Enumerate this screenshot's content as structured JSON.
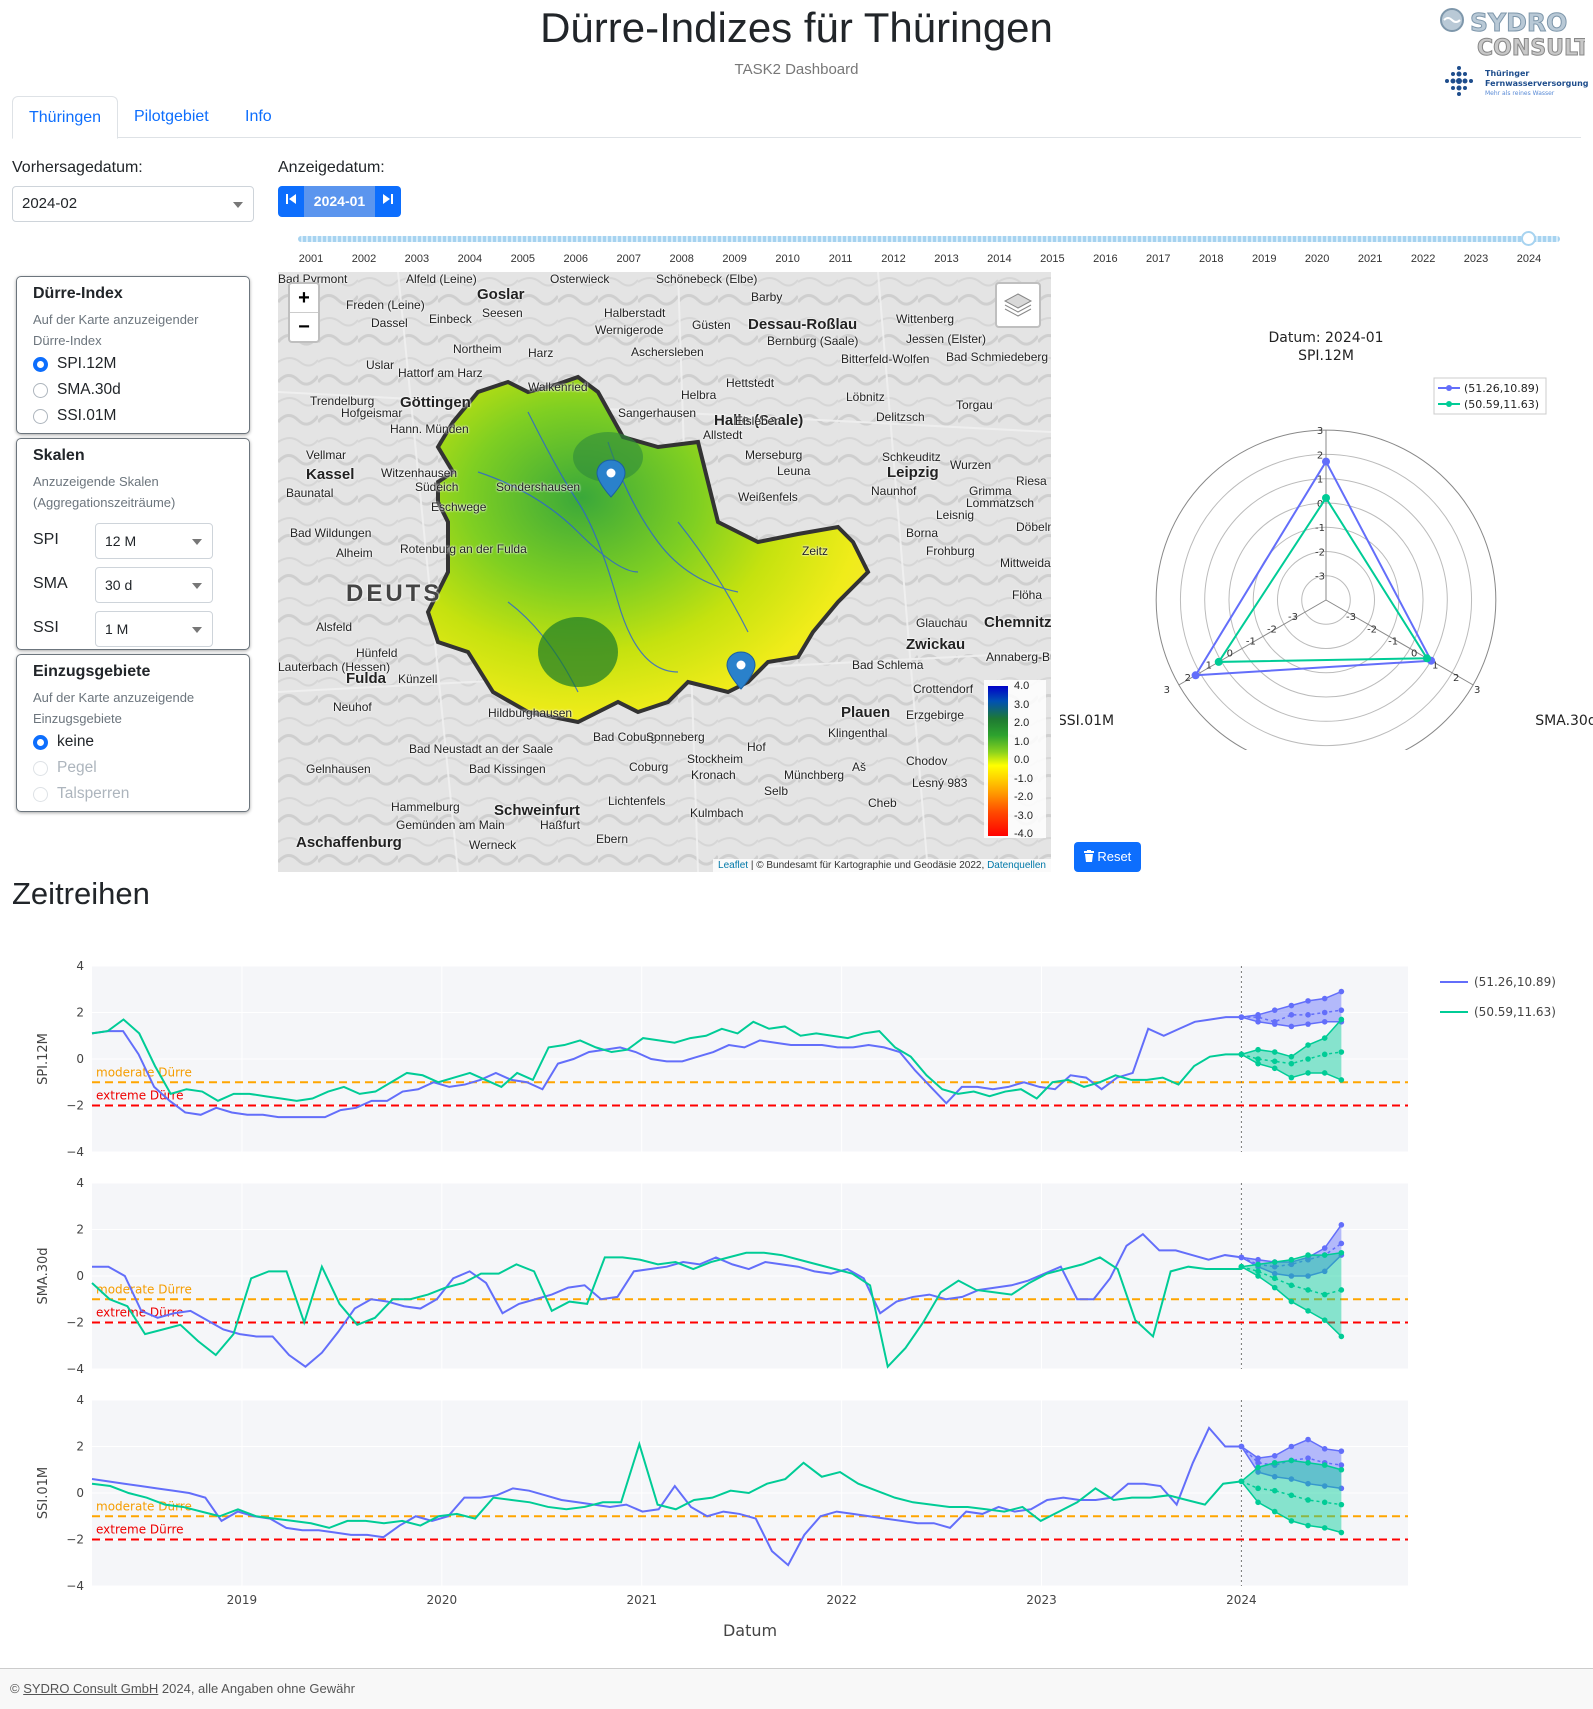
{
  "header": {
    "title": "Dürre-Indizes für Thüringen",
    "subtitle": "TASK2 Dashboard",
    "logo1": "SYDRO CONSULT",
    "logo2_line1": "Thüringer",
    "logo2_line2": "Fernwasserversorgung",
    "logo2_line3": "Mehr als reines Wasser"
  },
  "tabs": [
    {
      "label": "Thüringen",
      "active": true
    },
    {
      "label": "Pilotgebiet",
      "active": false
    },
    {
      "label": "Info",
      "active": false
    }
  ],
  "controls": {
    "vorhersage_label": "Vorhersagedatum:",
    "vorhersage_value": "2024-02",
    "anzeige_label": "Anzeigedatum:",
    "anzeige_value": "2024-01",
    "slider_years": [
      "2001",
      "2002",
      "2003",
      "2004",
      "2005",
      "2006",
      "2007",
      "2008",
      "2009",
      "2010",
      "2011",
      "2012",
      "2013",
      "2014",
      "2015",
      "2016",
      "2017",
      "2018",
      "2019",
      "2020",
      "2021",
      "2022",
      "2023",
      "2024"
    ],
    "slider_position": 1.0
  },
  "panels": {
    "index": {
      "title": "Dürre-Index",
      "desc": "Auf der Karte anzuzeigender Dürre-Index",
      "options": [
        {
          "label": "SPI.12M",
          "checked": true
        },
        {
          "label": "SMA.30d",
          "checked": false
        },
        {
          "label": "SSI.01M",
          "checked": false
        }
      ]
    },
    "scales": {
      "title": "Skalen",
      "desc": "Anzuzeigende Skalen (Aggregationszeiträume)",
      "rows": [
        {
          "label": "SPI",
          "value": "12 M"
        },
        {
          "label": "SMA",
          "value": "30 d"
        },
        {
          "label": "SSI",
          "value": "1 M"
        }
      ]
    },
    "catchments": {
      "title": "Einzugsgebiete",
      "desc": "Auf der Karte anzuzeigende Einzugsgebiete",
      "options": [
        {
          "label": "keine",
          "checked": true,
          "disabled": false
        },
        {
          "label": "Pegel",
          "checked": false,
          "disabled": true
        },
        {
          "label": "Talsperren",
          "checked": false,
          "disabled": true
        }
      ]
    }
  },
  "map": {
    "zoom_in": "+",
    "zoom_out": "−",
    "attribution_leaflet": "Leaflet",
    "attribution_text": " | © Bundesamt für Kartographie und Geodäsie 2022, ",
    "attribution_link": "Datenquellen",
    "legend_ticks": [
      "4.0",
      "3.0",
      "2.0",
      "1.0",
      "0.0",
      "-1.0",
      "-2.0",
      "-3.0",
      "-4.0"
    ],
    "towns": [
      {
        "name": "Bad Pyrmont"
      },
      {
        "name": "Alfeld (Leine)"
      },
      {
        "name": "Goslar"
      },
      {
        "name": "Osterwieck"
      },
      {
        "name": "Schönebeck (Elbe)"
      },
      {
        "name": "Barby"
      },
      {
        "name": "Freden (Leine)"
      },
      {
        "name": "Halberstadt"
      },
      {
        "name": "Dessau-Roßlau"
      },
      {
        "name": "Wittenberg"
      },
      {
        "name": "Dassel"
      },
      {
        "name": "Einbeck"
      },
      {
        "name": "Seesen"
      },
      {
        "name": "Wernigerode"
      },
      {
        "name": "Güsten"
      },
      {
        "name": "Bernburg (Saale)"
      },
      {
        "name": "Jessen (Elster)"
      },
      {
        "name": "Northeim"
      },
      {
        "name": "Harz"
      },
      {
        "name": "Aschersleben"
      },
      {
        "name": "Bitterfeld-Wolfen"
      },
      {
        "name": "Bad Schmiedeberg"
      },
      {
        "name": "Uslar"
      },
      {
        "name": "Hattorf am Harz"
      },
      {
        "name": "Hettstedt"
      },
      {
        "name": "Walkenried"
      },
      {
        "name": "Löbnitz"
      },
      {
        "name": "Trendelburg"
      },
      {
        "name": "Göttingen"
      },
      {
        "name": "Helbra"
      },
      {
        "name": "Torgau"
      },
      {
        "name": "Hofgeismar"
      },
      {
        "name": "Sangerhausen"
      },
      {
        "name": "Halle (Saale)"
      },
      {
        "name": "Delitzsch"
      },
      {
        "name": "Hann. Münden"
      },
      {
        "name": "Eisleben"
      },
      {
        "name": "Allstedt"
      },
      {
        "name": "Vellmar"
      },
      {
        "name": "Merseburg"
      },
      {
        "name": "Schkeuditz"
      },
      {
        "name": "Wurzen"
      },
      {
        "name": "Kassel"
      },
      {
        "name": "Witzenhausen"
      },
      {
        "name": "Leuna"
      },
      {
        "name": "Leipzig"
      },
      {
        "name": "Baunatal"
      },
      {
        "name": "Sondershausen"
      },
      {
        "name": "Naunhof"
      },
      {
        "name": "Riesa"
      },
      {
        "name": "Südeich"
      },
      {
        "name": "Weißenfels"
      },
      {
        "name": "Grimma"
      },
      {
        "name": "Lommatzsch"
      },
      {
        "name": "Eschwege"
      },
      {
        "name": "Leisnig"
      },
      {
        "name": "Bad Wildungen"
      },
      {
        "name": "Borna"
      },
      {
        "name": "Döbeln"
      },
      {
        "name": "Rotenburg an der Fulda"
      },
      {
        "name": "Alheim"
      },
      {
        "name": "Zeitz"
      },
      {
        "name": "Frohburg"
      },
      {
        "name": "Mittweida"
      },
      {
        "name": "DEUTS"
      },
      {
        "name": "Flöha"
      },
      {
        "name": "Alsfeld"
      },
      {
        "name": "Glauchau"
      },
      {
        "name": "Chemnitz"
      },
      {
        "name": "Zwickau"
      },
      {
        "name": "Hünfeld"
      },
      {
        "name": "Lauterbach (Hessen)"
      },
      {
        "name": "Fulda"
      },
      {
        "name": "Künzell"
      },
      {
        "name": "Bad Schlema"
      },
      {
        "name": "Annaberg-Buchholz"
      },
      {
        "name": "Crottendorf"
      },
      {
        "name": "Neuhof"
      },
      {
        "name": "Plauen"
      },
      {
        "name": "Hildburghausen"
      },
      {
        "name": "Erzgebirge"
      },
      {
        "name": "Klingenthal"
      },
      {
        "name": "Bad Coburg"
      },
      {
        "name": "Sonneberg"
      },
      {
        "name": "Gelnhausen"
      },
      {
        "name": "Bad Neustadt an der Saale"
      },
      {
        "name": "Hof"
      },
      {
        "name": "Bad Kissingen"
      },
      {
        "name": "Coburg"
      },
      {
        "name": "Stockheim"
      },
      {
        "name": "Chodov"
      },
      {
        "name": "Kronach"
      },
      {
        "name": "Münchberg"
      },
      {
        "name": "Aš"
      },
      {
        "name": "Selb"
      },
      {
        "name": "Cheb"
      },
      {
        "name": "Hammelburg"
      },
      {
        "name": "Schweinfurt"
      },
      {
        "name": "Lichtenfels"
      },
      {
        "name": "Gemünden am Main"
      },
      {
        "name": "Haßfurt"
      },
      {
        "name": "Ebern"
      },
      {
        "name": "Kulmbach"
      },
      {
        "name": "Aschaffenburg"
      },
      {
        "name": "Werneck"
      },
      {
        "name": "Lesný 983"
      }
    ],
    "markers": [
      {
        "lat": 51.26,
        "lon": 10.89
      },
      {
        "lat": 50.59,
        "lon": 11.63
      }
    ]
  },
  "radar": {
    "title_line1": "Datum: 2024-01",
    "axes": [
      "SPI.12M",
      "SMA.30d",
      "SSI.01M"
    ],
    "radial_ticks": [
      "-3",
      "-2",
      "-1",
      "0",
      "1",
      "2",
      "3"
    ],
    "range": [
      -4,
      3
    ],
    "series": [
      {
        "name": "(51.26,10.89)",
        "color": "#636efa",
        "values": [
          1.7,
          1.0,
          2.2
        ]
      },
      {
        "name": "(50.59,11.63)",
        "color": "#00cc96",
        "values": [
          0.2,
          0.8,
          1.1
        ]
      }
    ]
  },
  "reset_label": "Reset",
  "section_title": "Zeitreihen",
  "chart_data": {
    "type": "line",
    "x_start": "2018-04",
    "x_ticks": [
      "2019",
      "2020",
      "2021",
      "2022",
      "2023",
      "2024"
    ],
    "xlabel": "Datum",
    "ylim": [
      -4,
      4
    ],
    "y_ticks": [
      "4",
      "2",
      "0",
      "−2",
      "−4"
    ],
    "forecast_start": "2024-01",
    "thresholds": [
      {
        "label": "moderate Dürre",
        "value": -1,
        "color": "#ffa500"
      },
      {
        "label": "extreme Dürre",
        "value": -2,
        "color": "#ff0000"
      }
    ],
    "series_names": [
      "(51.26,10.89)",
      "(50.59,11.63)"
    ],
    "series_colors": [
      "#636efa",
      "#00cc96"
    ],
    "panels": [
      {
        "ylabel": "SPI.12M",
        "blue": [
          1.1,
          1.2,
          1.2,
          0.2,
          -1.2,
          -1.8,
          -2.3,
          -2.4,
          -2.1,
          -2.3,
          -2.4,
          -2.4,
          -2.5,
          -2.5,
          -2.5,
          -2.5,
          -2.2,
          -2.1,
          -1.8,
          -1.8,
          -1.4,
          -1.3,
          -1.0,
          -1.2,
          -1.1,
          -0.9,
          -0.6,
          -0.9,
          -1.0,
          -1.3,
          -0.2,
          0.0,
          0.3,
          0.4,
          0.5,
          0.3,
          0.0,
          -0.1,
          -0.1,
          0.1,
          0.3,
          0.6,
          0.5,
          0.8,
          0.7,
          0.6,
          0.6,
          0.6,
          0.5,
          0.5,
          0.6,
          0.5,
          0.3,
          -0.5,
          -1.2,
          -1.9,
          -1.2,
          -1.2,
          -1.3,
          -1.2,
          -1.0,
          -1.2,
          -1.3,
          -0.7,
          -0.8,
          -1.3,
          -0.8,
          -0.6,
          1.3,
          1.0,
          1.3,
          1.6,
          1.7,
          1.8,
          1.8
        ],
        "green": [
          1.1,
          1.2,
          1.7,
          1.1,
          -0.3,
          -1.5,
          -1.3,
          -1.4,
          -1.8,
          -1.5,
          -1.5,
          -1.6,
          -1.7,
          -1.8,
          -1.7,
          -1.4,
          -1.2,
          -1.5,
          -1.4,
          -1.0,
          -0.6,
          -0.7,
          -1.0,
          -0.8,
          -0.6,
          -0.9,
          -1.2,
          -0.6,
          -0.9,
          0.5,
          0.6,
          0.8,
          0.5,
          0.3,
          0.4,
          0.9,
          0.8,
          0.7,
          0.9,
          1.0,
          1.3,
          1.1,
          1.6,
          1.3,
          1.4,
          1.0,
          1.1,
          1.0,
          0.9,
          1.1,
          1.2,
          0.5,
          0.1,
          -0.7,
          -1.3,
          -1.5,
          -1.4,
          -1.6,
          -1.4,
          -1.3,
          -1.7,
          -1.0,
          -0.9,
          -1.2,
          -1.0,
          -0.7,
          -0.9,
          -0.9,
          -0.8,
          -1.1,
          -0.3,
          0.1,
          0.2,
          0.2
        ],
        "fc_blue": {
          "upper": [
            1.8,
            1.9,
            2.1,
            2.3,
            2.5,
            2.6,
            2.9
          ],
          "mid": [
            1.8,
            1.8,
            1.6,
            1.9,
            1.9,
            2.0,
            2.1
          ],
          "lower": [
            1.8,
            1.6,
            1.5,
            1.4,
            1.5,
            1.6,
            1.6
          ]
        },
        "fc_green": {
          "upper": [
            0.2,
            0.4,
            0.3,
            0.1,
            0.6,
            0.9,
            1.7
          ],
          "mid": [
            0.2,
            0.0,
            -0.1,
            -0.2,
            0.0,
            0.2,
            0.3
          ],
          "lower": [
            0.2,
            -0.2,
            -0.4,
            -0.8,
            -0.6,
            -0.6,
            -0.9
          ]
        }
      },
      {
        "ylabel": "SMA.30d",
        "blue": [
          0.4,
          0.4,
          0.0,
          -1.5,
          -1.8,
          -1.6,
          -1.5,
          -1.9,
          -2.3,
          -2.5,
          -2.6,
          -2.6,
          -3.4,
          -3.9,
          -3.3,
          -2.4,
          -1.4,
          -1.0,
          -1.1,
          -1.3,
          -1.4,
          -1.0,
          -0.1,
          0.2,
          -0.3,
          -1.6,
          -1.2,
          -1.0,
          -0.8,
          -0.5,
          -0.4,
          -1.0,
          -0.9,
          0.2,
          0.3,
          0.4,
          0.6,
          0.5,
          0.8,
          0.5,
          0.3,
          0.6,
          0.5,
          0.4,
          0.2,
          0.1,
          0.3,
          -0.1,
          -1.6,
          -1.1,
          -0.9,
          -0.8,
          -1.0,
          -0.9,
          -0.6,
          -0.5,
          -0.4,
          -0.2,
          0.1,
          0.4,
          -1.0,
          -1.0,
          -0.1,
          1.3,
          1.8,
          1.1,
          1.1,
          0.9,
          0.7,
          0.9,
          0.8
        ],
        "green": [
          -0.3,
          -1.0,
          -1.3,
          -2.5,
          -2.3,
          -2.1,
          -2.8,
          -3.4,
          -2.5,
          -0.1,
          0.2,
          0.2,
          -2.0,
          0.4,
          -1.2,
          -2.1,
          -1.8,
          -1.0,
          -1.0,
          -0.8,
          -0.5,
          -0.3,
          0.1,
          0.1,
          0.5,
          0.2,
          -1.5,
          -1.1,
          -1.2,
          0.8,
          0.8,
          0.7,
          0.5,
          0.6,
          0.3,
          0.6,
          0.8,
          1.0,
          1.0,
          0.9,
          0.7,
          0.5,
          0.3,
          0.1,
          -0.4,
          -3.9,
          -3.1,
          -2.0,
          -0.7,
          -0.2,
          -0.6,
          -0.7,
          -0.8,
          -0.3,
          0.1,
          0.3,
          0.5,
          0.8,
          0.3,
          -1.9,
          -2.6,
          0.2,
          0.4,
          0.3,
          0.3,
          0.3
        ],
        "fc_blue": {
          "upper": [
            0.8,
            0.7,
            0.6,
            0.6,
            0.8,
            1.2,
            2.2
          ],
          "mid": [
            0.8,
            0.5,
            0.4,
            0.5,
            0.7,
            0.9,
            1.4
          ],
          "lower": [
            0.8,
            0.4,
            0.1,
            0.0,
            0.0,
            0.2,
            0.9
          ]
        },
        "fc_green": {
          "upper": [
            0.4,
            0.5,
            0.6,
            0.7,
            0.9,
            0.9,
            1.0
          ],
          "mid": [
            0.4,
            0.2,
            -0.1,
            -0.4,
            -0.6,
            -0.8,
            -0.6
          ],
          "lower": [
            0.4,
            0.0,
            -0.5,
            -1.1,
            -1.5,
            -1.9,
            -2.6
          ]
        }
      },
      {
        "ylabel": "SSI.01M",
        "blue": [
          0.6,
          0.5,
          0.4,
          0.3,
          0.2,
          0.1,
          0.0,
          -0.2,
          -1.2,
          -0.8,
          -1.0,
          -1.1,
          -1.5,
          -1.6,
          -1.6,
          -1.7,
          -1.8,
          -1.8,
          -1.9,
          -1.4,
          -1.0,
          -1.2,
          -1.0,
          -0.2,
          -0.2,
          -0.1,
          0.2,
          0.1,
          -0.1,
          -0.3,
          -0.4,
          -0.5,
          -0.6,
          -0.5,
          -0.8,
          -0.7,
          0.3,
          -0.6,
          -1.0,
          -0.8,
          -0.9,
          -1.1,
          -2.5,
          -3.1,
          -1.8,
          -1.0,
          -0.8,
          -0.9,
          -1.0,
          -1.1,
          -1.2,
          -1.3,
          -1.3,
          -1.5,
          -0.8,
          -0.9,
          -0.6,
          -0.8,
          -0.7,
          -0.3,
          -0.2,
          -0.3,
          -0.3,
          -0.2,
          0.4,
          0.4,
          0.3,
          -0.5,
          1.3,
          2.8,
          2.0,
          2.0
        ],
        "green": [
          0.4,
          0.3,
          0.0,
          -0.2,
          -0.5,
          -0.6,
          -0.8,
          -1.0,
          -0.7,
          -1.0,
          -1.1,
          -1.2,
          -1.3,
          -1.5,
          -1.2,
          -1.2,
          -1.3,
          -1.2,
          -1.4,
          -1.0,
          -0.9,
          -1.1,
          -0.2,
          -0.3,
          -0.4,
          -0.6,
          -0.7,
          -0.6,
          -0.4,
          -0.4,
          2.1,
          -0.5,
          -0.7,
          -0.3,
          -0.2,
          0.1,
          0.0,
          0.4,
          0.6,
          1.3,
          0.7,
          0.9,
          0.4,
          0.1,
          -0.2,
          -0.4,
          -0.5,
          -0.6,
          -0.6,
          -0.7,
          -0.8,
          -0.6,
          -1.2,
          -0.8,
          -0.4,
          0.2,
          -0.3,
          -0.2,
          -0.2,
          -0.1,
          -0.3,
          -0.5,
          0.4,
          0.5
        ],
        "fc_blue": {
          "upper": [
            2.0,
            1.5,
            1.6,
            2.0,
            2.3,
            1.9,
            1.8
          ],
          "mid": [
            2.0,
            1.3,
            1.2,
            1.4,
            1.5,
            1.3,
            1.2
          ],
          "lower": [
            2.0,
            0.9,
            0.7,
            0.6,
            0.4,
            0.3,
            0.2
          ]
        },
        "fc_green": {
          "upper": [
            0.5,
            1.1,
            1.3,
            1.4,
            1.3,
            1.2,
            1.0
          ],
          "mid": [
            0.5,
            0.2,
            0.1,
            -0.1,
            -0.3,
            -0.4,
            -0.5
          ],
          "lower": [
            0.5,
            -0.4,
            -0.8,
            -1.2,
            -1.4,
            -1.5,
            -1.7
          ]
        }
      }
    ]
  },
  "footer": {
    "prefix": "© ",
    "link": "SYDRO Consult GmbH",
    "suffix": " 2024, alle Angaben ohne Gewähr"
  }
}
